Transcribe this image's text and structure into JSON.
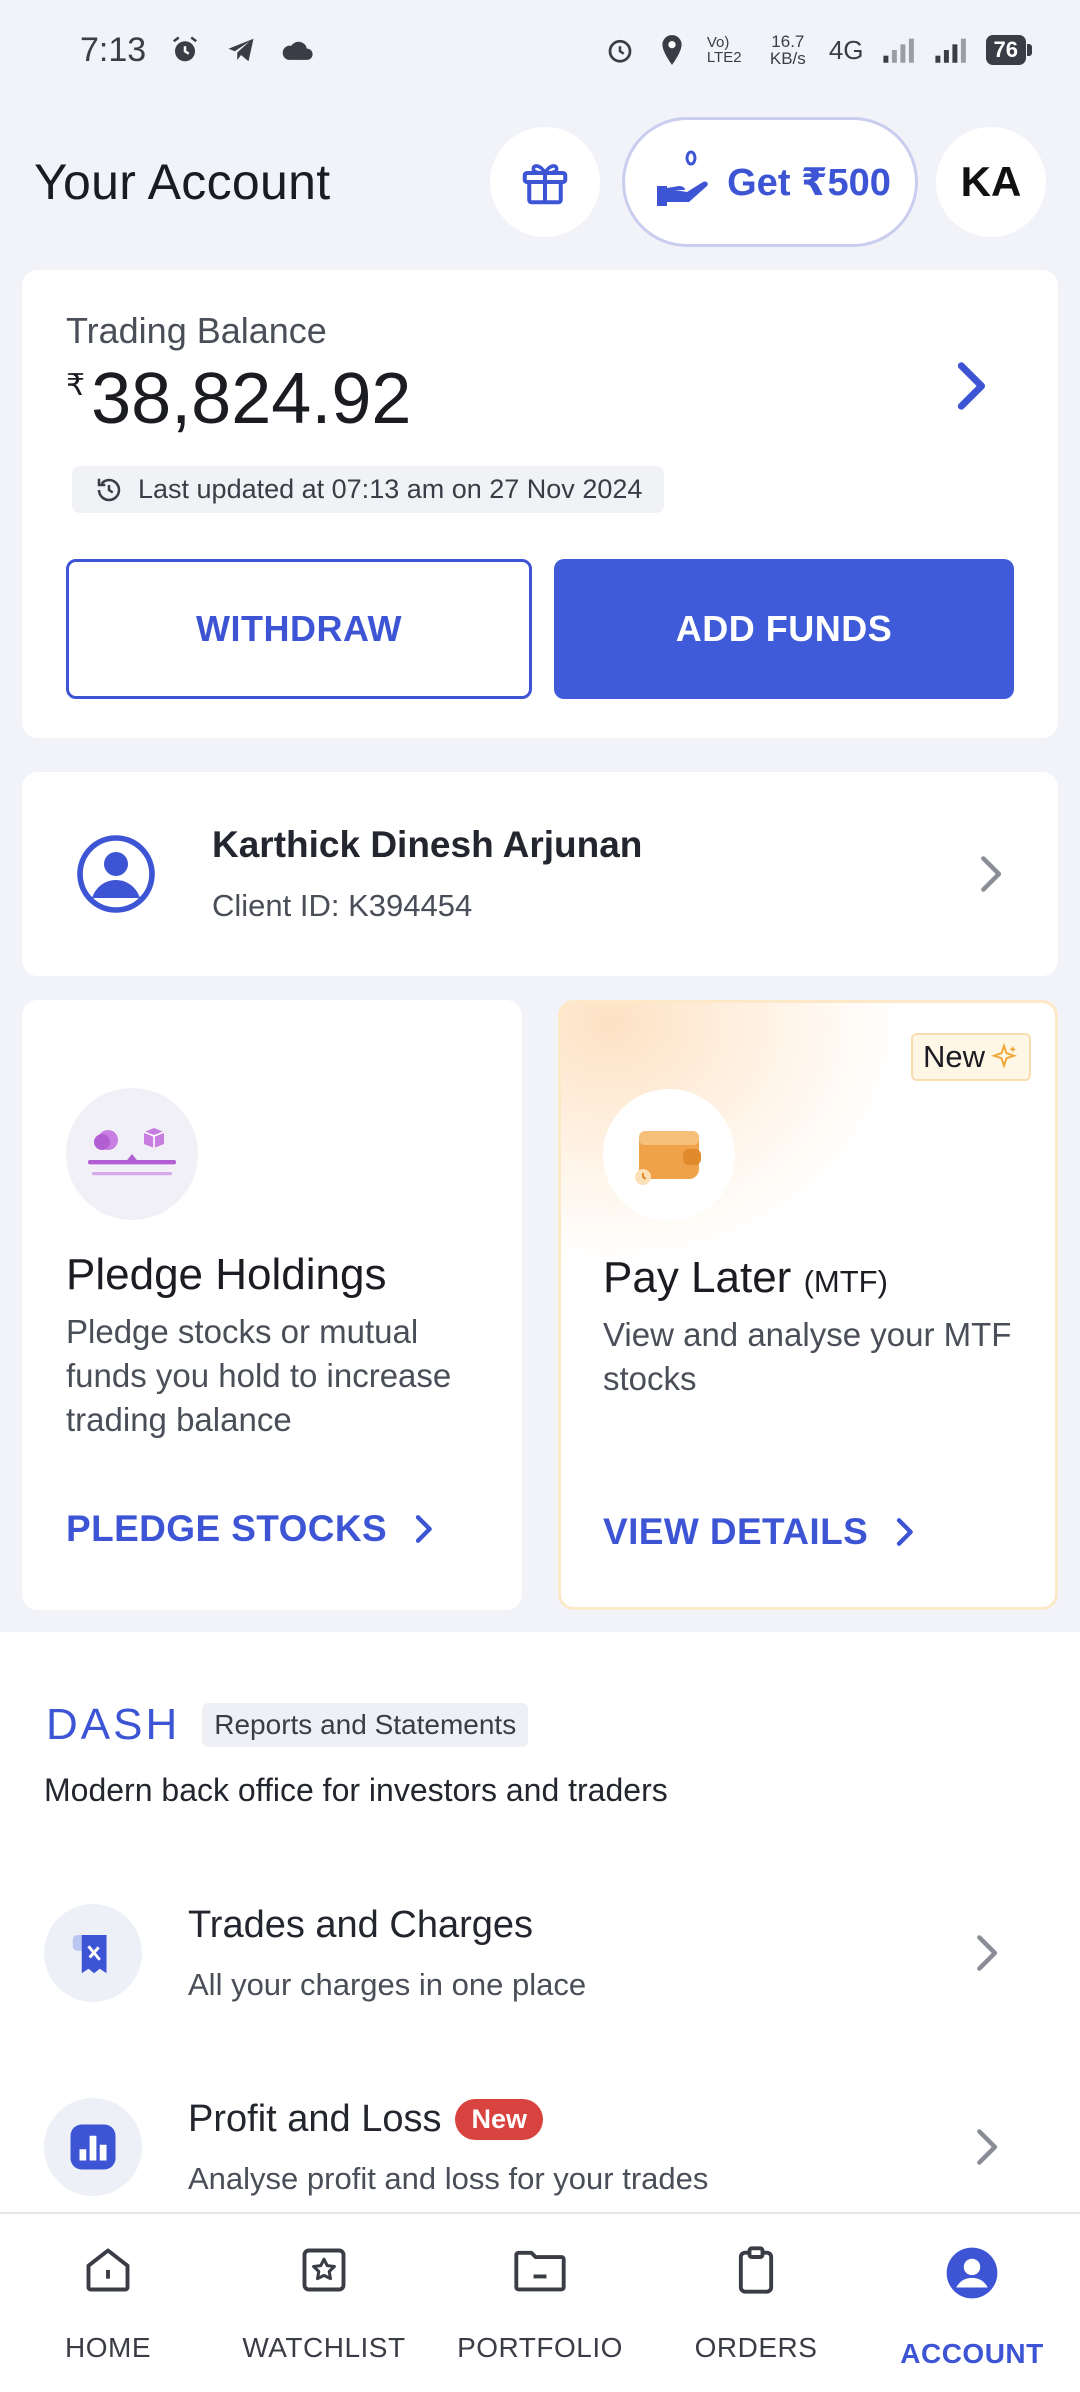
{
  "status_bar": {
    "time": "7:13",
    "net_speed": "16.7 KB/s",
    "net_type": "4G",
    "volte": "Vo) LTE2",
    "battery": "76"
  },
  "header": {
    "title": "Your Account",
    "refer_label": "Get ₹500",
    "avatar_initials": "KA"
  },
  "balance": {
    "label": "Trading Balance",
    "currency": "₹",
    "amount": "38,824.92",
    "updated": "Last updated at 07:13 am on 27 Nov 2024",
    "withdraw_label": "WITHDRAW",
    "add_funds_label": "ADD FUNDS"
  },
  "profile": {
    "name": "Karthick Dinesh Arjunan",
    "client_id": "Client ID: K394454"
  },
  "pledge": {
    "title": "Pledge Holdings",
    "description": "Pledge stocks or mutual funds you hold to increase trading balance",
    "link": "PLEDGE STOCKS"
  },
  "pay_later": {
    "badge": "New",
    "title": "Pay Later",
    "title_suffix": "(MTF)",
    "description": "View and analyse your MTF stocks",
    "link": "VIEW DETAILS"
  },
  "dash": {
    "logo": "DASH",
    "pill": "Reports and Statements",
    "subtitle": "Modern back office for investors and traders",
    "items": [
      {
        "title": "Trades and Charges",
        "subtitle": "All your charges in one place"
      },
      {
        "title": "Profit and Loss",
        "badge": "New",
        "subtitle": "Analyse profit and loss for your trades"
      }
    ]
  },
  "nav": {
    "items": [
      {
        "label": "HOME"
      },
      {
        "label": "WATCHLIST"
      },
      {
        "label": "PORTFOLIO"
      },
      {
        "label": "ORDERS"
      },
      {
        "label": "ACCOUNT"
      }
    ],
    "active": "ACCOUNT"
  },
  "colors": {
    "accent": "#3d55d4",
    "background": "#f2f3f8",
    "new_badge": "#d9433f"
  }
}
